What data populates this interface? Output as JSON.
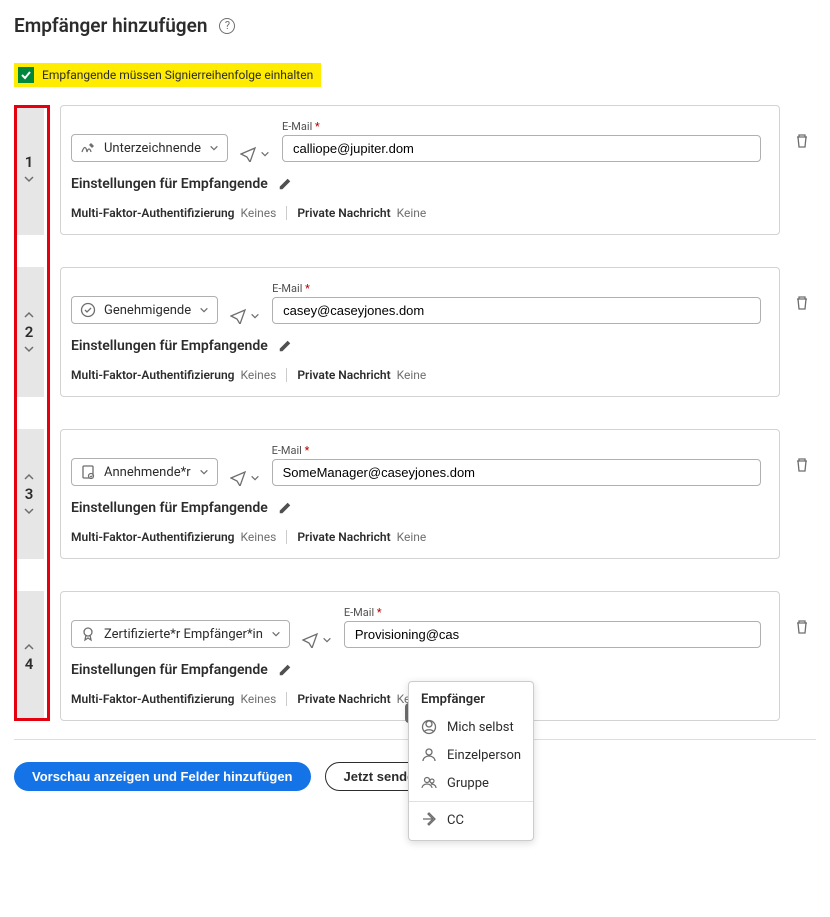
{
  "header": {
    "title": "Empfänger hinzufügen"
  },
  "checkbox": {
    "label": "Empfangende müssen Signierreihenfolge einhalten"
  },
  "labels": {
    "email": "E-Mail",
    "settings": "Einstellungen für Empfangende",
    "mfa": "Multi-Faktor-Authentifizierung",
    "none": "Keines",
    "private": "Private Nachricht",
    "none2": "Keine"
  },
  "recipients": [
    {
      "order": "1",
      "role": "Unterzeichnende",
      "email": "calliope@jupiter.dom"
    },
    {
      "order": "2",
      "role": "Genehmigende",
      "email": "casey@caseyjones.dom"
    },
    {
      "order": "3",
      "role": "Annehmende*r",
      "email": "SomeManager@caseyjones.dom"
    },
    {
      "order": "4",
      "role": "Zertifizierte*r Empfänger*in",
      "email": "Provisioning@cas"
    }
  ],
  "popup": {
    "title": "Empfänger",
    "items": [
      "Mich selbst",
      "Einzelperson",
      "Gruppe",
      "CC"
    ]
  },
  "buttons": {
    "preview": "Vorschau anzeigen und Felder hinzufügen",
    "send": "Jetzt senden"
  }
}
